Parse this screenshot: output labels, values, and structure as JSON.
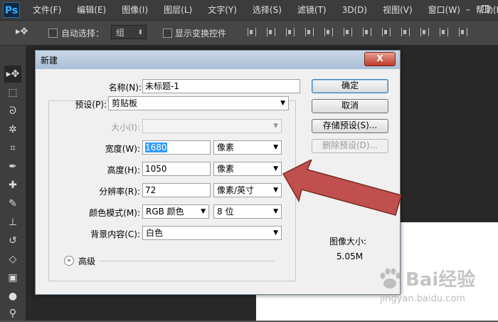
{
  "app": {
    "logo": "Ps",
    "menu": [
      "文件(F)",
      "编辑(E)",
      "图像(I)",
      "图层(L)",
      "文字(Y)",
      "选择(S)",
      "滤镜(T)",
      "3D(D)",
      "视图(V)",
      "窗口(W)",
      "帮助(H)"
    ]
  },
  "options": {
    "auto_select_label": "自动选择：",
    "auto_select_value": "组",
    "show_transform_label": "显示变换控件"
  },
  "dialog": {
    "title": "新建",
    "close_label": "X",
    "name_label": "名称(N):",
    "name_value": "未标题-1",
    "preset_label": "预设(P):",
    "preset_value": "剪贴板",
    "size_label": "大小(I):",
    "size_value": "",
    "width_label": "宽度(W):",
    "width_value": "1680",
    "width_unit": "像素",
    "height_label": "高度(H):",
    "height_value": "1050",
    "height_unit": "像素",
    "resolution_label": "分辨率(R):",
    "resolution_value": "72",
    "resolution_unit": "像素/英寸",
    "color_mode_label": "颜色模式(M):",
    "color_mode_value": "RGB 颜色",
    "bit_depth_value": "8 位",
    "background_label": "背景内容(C):",
    "background_value": "白色",
    "advanced_label": "高级",
    "ok_button": "确定",
    "cancel_button": "取消",
    "save_preset_button": "存储预设(S)...",
    "delete_preset_button": "删除预设(D)...",
    "image_size_label": "图像大小:",
    "image_size_value": "5.05M"
  },
  "watermark": {
    "brand": "Bai经验",
    "url": "jingyan.baidu.com"
  },
  "colors": {
    "arrow": "#c0504d",
    "dialog_bg": "#f0f0f0",
    "workspace": "#282828",
    "default_button_border": "#3c7fb1"
  }
}
